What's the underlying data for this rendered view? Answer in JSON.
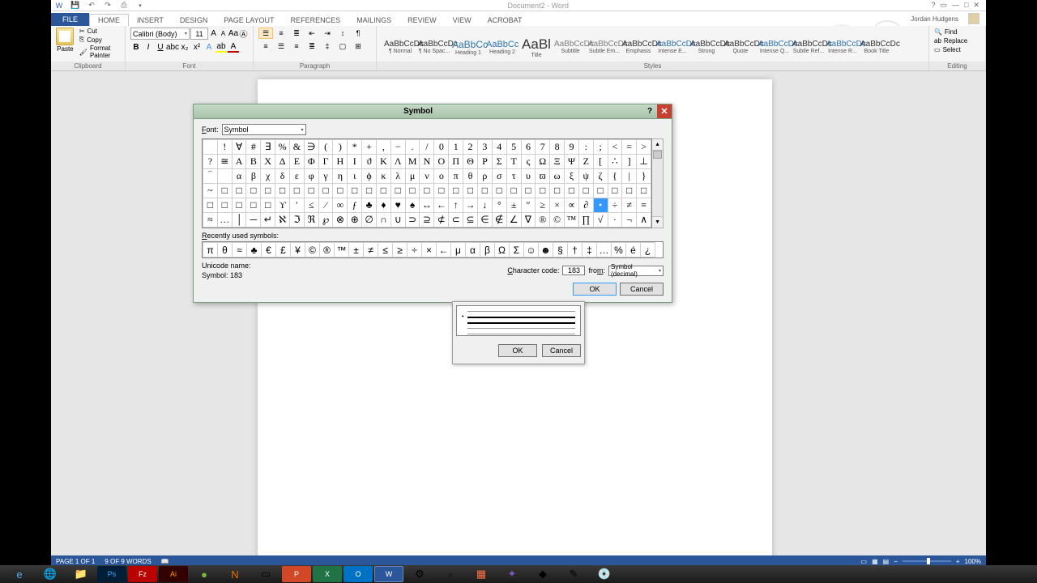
{
  "window": {
    "title": "Document2 - Word",
    "user": "Jordan Hudgens"
  },
  "ribbon": {
    "tabs": [
      "FILE",
      "HOME",
      "INSERT",
      "DESIGN",
      "PAGE LAYOUT",
      "REFERENCES",
      "MAILINGS",
      "REVIEW",
      "VIEW",
      "ACROBAT"
    ],
    "active_tab": "HOME",
    "clipboard": {
      "paste": "Paste",
      "cut": "Cut",
      "copy": "Copy",
      "format_painter": "Format Painter",
      "group_label": "Clipboard"
    },
    "font": {
      "name": "Calibri (Body)",
      "size": "11",
      "group_label": "Font"
    },
    "paragraph": {
      "group_label": "Paragraph"
    },
    "styles": {
      "group_label": "Styles",
      "items": [
        {
          "preview": "AaBbCcDc",
          "name": "¶ Normal"
        },
        {
          "preview": "AaBbCcDc",
          "name": "¶ No Spac..."
        },
        {
          "preview": "AaBbCc",
          "name": "Heading 1"
        },
        {
          "preview": "AaBbCc",
          "name": "Heading 2"
        },
        {
          "preview": "AaBl",
          "name": "Title"
        },
        {
          "preview": "AaBbCcDc",
          "name": "Subtitle"
        },
        {
          "preview": "AaBbCcDc",
          "name": "Subtle Em..."
        },
        {
          "preview": "AaBbCcDc",
          "name": "Emphasis"
        },
        {
          "preview": "AaBbCcDc",
          "name": "Intense E..."
        },
        {
          "preview": "AaBbCcDc",
          "name": "Strong"
        },
        {
          "preview": "AaBbCcDc",
          "name": "Quote"
        },
        {
          "preview": "AaBbCcDc",
          "name": "Intense Q..."
        },
        {
          "preview": "AaBbCcDc",
          "name": "Subtle Ref..."
        },
        {
          "preview": "AaBbCcDc",
          "name": "Intense R..."
        },
        {
          "preview": "AaBbCcDc",
          "name": "Book Title"
        }
      ]
    },
    "editing": {
      "find": "Find",
      "replace": "Replace",
      "select": "Select",
      "group_label": "Editing"
    }
  },
  "symbol_dialog": {
    "title": "Symbol",
    "font_label": "Font:",
    "font_value": "Symbol",
    "grid": [
      [
        " ",
        "!",
        "∀",
        "#",
        "∃",
        "%",
        "&",
        "∋",
        "(",
        ")",
        "*",
        "+",
        ",",
        "−",
        ".",
        "/",
        "0",
        "1",
        "2",
        "3",
        "4",
        "5",
        "6",
        "7",
        "8",
        "9",
        ":",
        ";",
        "<",
        "=",
        ">"
      ],
      [
        "?",
        "≅",
        "Α",
        "Β",
        "Χ",
        "Δ",
        "Ε",
        "Φ",
        "Γ",
        "Η",
        "Ι",
        "ϑ",
        "Κ",
        "Λ",
        "Μ",
        "Ν",
        "Ο",
        "Π",
        "Θ",
        "Ρ",
        "Σ",
        "Τ",
        "ς",
        "Ω",
        "Ξ",
        "Ψ",
        "Ζ",
        "[",
        "∴",
        "]",
        "⊥"
      ],
      [
        "‾",
        " ",
        "α",
        "β",
        "χ",
        "δ",
        "ε",
        "φ",
        "γ",
        "η",
        "ι",
        "ϕ",
        "κ",
        "λ",
        "μ",
        "ν",
        "ο",
        "π",
        "θ",
        "ρ",
        "σ",
        "τ",
        "υ",
        "ϖ",
        "ω",
        "ξ",
        "ψ",
        "ζ",
        "{",
        "|",
        "}"
      ],
      [
        "~",
        "□",
        "□",
        "□",
        "□",
        "□",
        "□",
        "□",
        "□",
        "□",
        "□",
        "□",
        "□",
        "□",
        "□",
        "□",
        "□",
        "□",
        "□",
        "□",
        "□",
        "□",
        "□",
        "□",
        "□",
        "□",
        "□",
        "□",
        "□",
        "□",
        "□"
      ],
      [
        "□",
        "□",
        "□",
        "□",
        "□",
        "ϒ",
        "′",
        "≤",
        "⁄",
        "∞",
        "ƒ",
        "♣",
        "♦",
        "♥",
        "♠",
        "↔",
        "←",
        "↑",
        "→",
        "↓",
        "°",
        "±",
        "″",
        "≥",
        "×",
        "∝",
        "∂",
        "•",
        "÷",
        "≠",
        "≡"
      ],
      [
        "≈",
        "…",
        "│",
        "─",
        "↵",
        "ℵ",
        "ℑ",
        "ℜ",
        "℘",
        "⊗",
        "⊕",
        "∅",
        "∩",
        "∪",
        "⊃",
        "⊇",
        "⊄",
        "⊂",
        "⊆",
        "∈",
        "∉",
        "∠",
        "∇",
        "®",
        "©",
        "™",
        "∏",
        "√",
        "·",
        "¬",
        "∧"
      ]
    ],
    "selected": {
      "row": 4,
      "col": 27
    },
    "recent_label": "Recently used symbols:",
    "recent": [
      "π",
      "θ",
      "≈",
      "♣",
      "€",
      "£",
      "¥",
      "©",
      "®",
      "™",
      "±",
      "≠",
      "≤",
      "≥",
      "÷",
      "×",
      "←",
      "μ",
      "α",
      "β",
      "Ω",
      "Σ",
      "☺",
      "☻",
      "§",
      "†",
      "‡",
      "…",
      "%",
      "é",
      "¿"
    ],
    "unicode_name_label": "Unicode name:",
    "symbol_code_label": "Symbol: 183",
    "char_code_label": "Character code:",
    "char_code": "183",
    "from_label": "from:",
    "from_value": "Symbol (decimal)",
    "ok": "OK",
    "cancel": "Cancel"
  },
  "sub_dialog": {
    "ok": "OK",
    "cancel": "Cancel"
  },
  "status": {
    "page": "PAGE 1 OF 1",
    "words": "9 OF 9 WORDS",
    "zoom": "100%"
  }
}
